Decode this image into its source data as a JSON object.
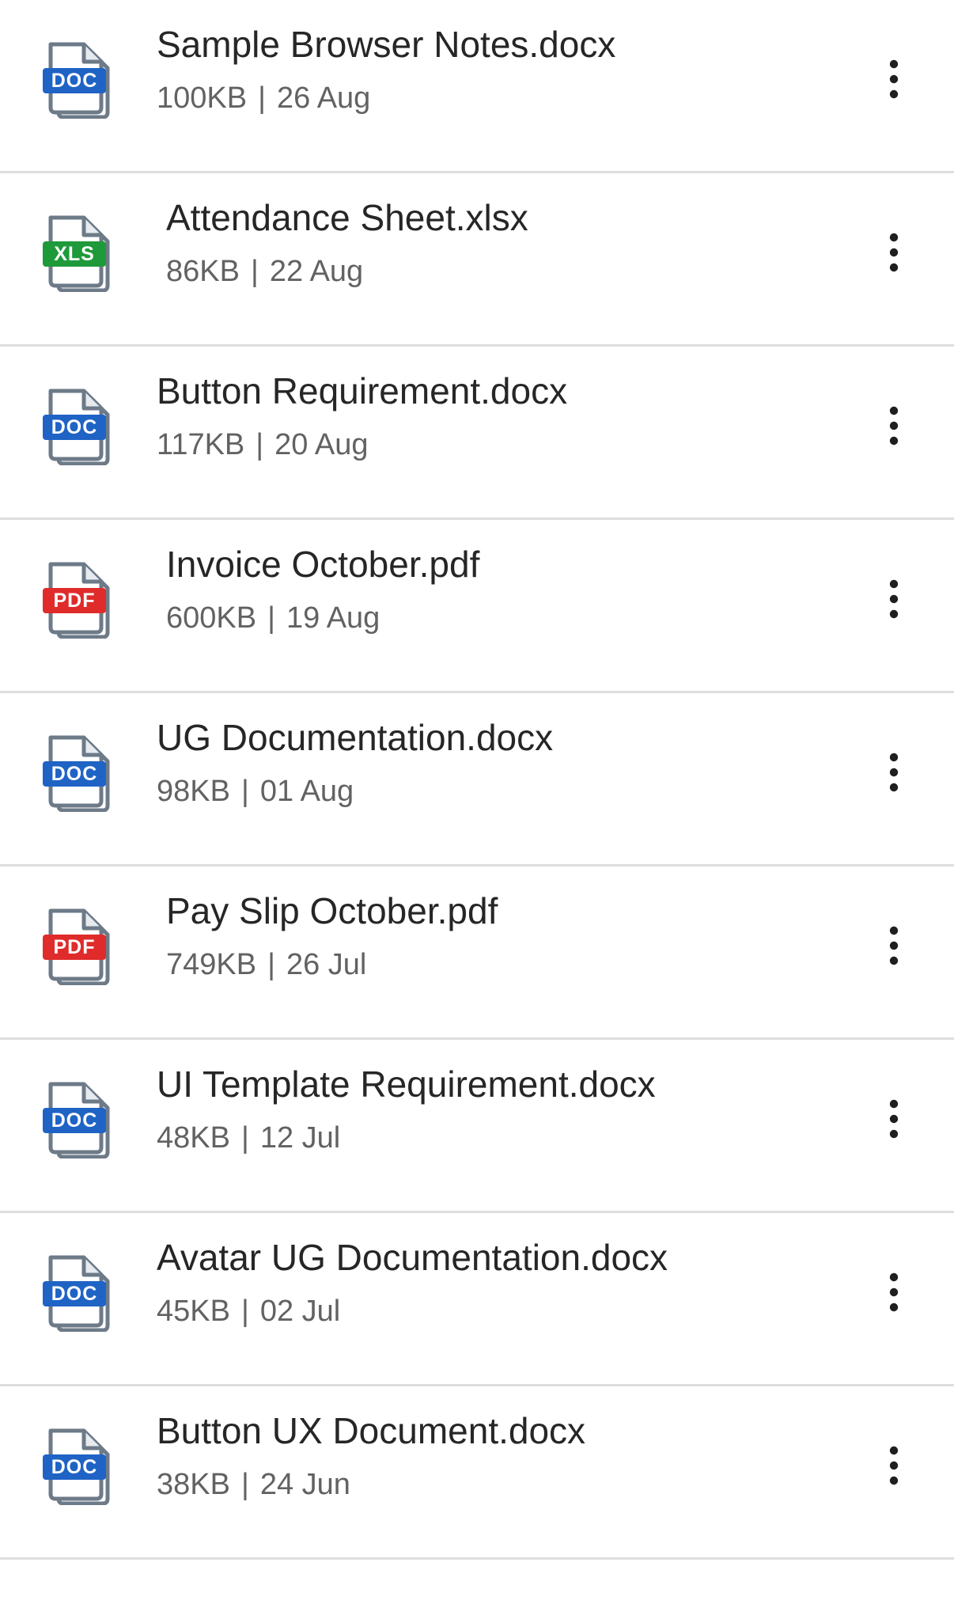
{
  "files": [
    {
      "name": "Sample Browser Notes.docx",
      "size": "100KB",
      "date": "26 Aug",
      "type": "DOC",
      "icon": "doc-icon"
    },
    {
      "name": "Attendance Sheet.xlsx",
      "size": "86KB",
      "date": "22 Aug",
      "type": "XLS",
      "icon": "xls-icon"
    },
    {
      "name": "Button Requirement.docx",
      "size": "117KB",
      "date": "20 Aug",
      "type": "DOC",
      "icon": "doc-icon"
    },
    {
      "name": "Invoice October.pdf",
      "size": "600KB",
      "date": "19 Aug",
      "type": "PDF",
      "icon": "pdf-icon"
    },
    {
      "name": "UG Documentation.docx",
      "size": "98KB",
      "date": "01 Aug",
      "type": "DOC",
      "icon": "doc-icon"
    },
    {
      "name": "Pay Slip October.pdf",
      "size": "749KB",
      "date": "26 Jul",
      "type": "PDF",
      "icon": "pdf-icon"
    },
    {
      "name": "UI Template Requirement.docx",
      "size": "48KB",
      "date": "12 Jul",
      "type": "DOC",
      "icon": "doc-icon"
    },
    {
      "name": "Avatar UG Documentation.docx",
      "size": "45KB",
      "date": "02 Jul",
      "type": "DOC",
      "icon": "doc-icon"
    },
    {
      "name": "Button UX Document.docx",
      "size": "38KB",
      "date": "24 Jun",
      "type": "DOC",
      "icon": "doc-icon"
    }
  ],
  "meta_separator": "|",
  "colors": {
    "doc": "#1f63c5",
    "xls": "#1e9a3a",
    "pdf": "#e02b2b",
    "divider": "#dedede",
    "title_text": "#262626",
    "meta_text": "#626262"
  }
}
